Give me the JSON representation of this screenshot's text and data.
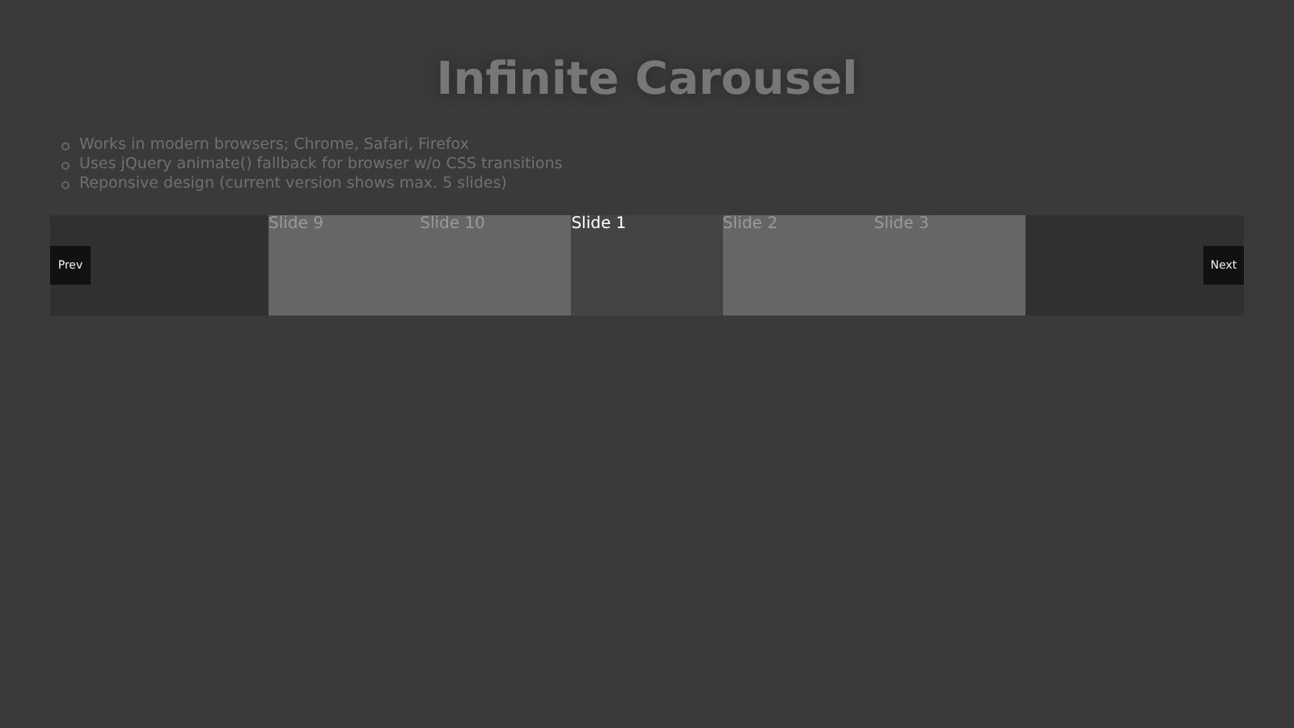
{
  "title": "Infinite Carousel",
  "features": [
    "Works in modern browsers; Chrome, Safari, Firefox",
    "Uses jQuery animate() fallback for browser w/o CSS transitions",
    "Reponsive design (current version shows max. 5 slides)"
  ],
  "carousel": {
    "prev": "Prev",
    "next": "Next",
    "slides": [
      {
        "label": "Slide 9",
        "selected": false
      },
      {
        "label": "Slide 10",
        "selected": false
      },
      {
        "label": "Slide 1",
        "selected": true
      },
      {
        "label": "Slide 2",
        "selected": false
      },
      {
        "label": "Slide 3",
        "selected": false
      }
    ]
  }
}
